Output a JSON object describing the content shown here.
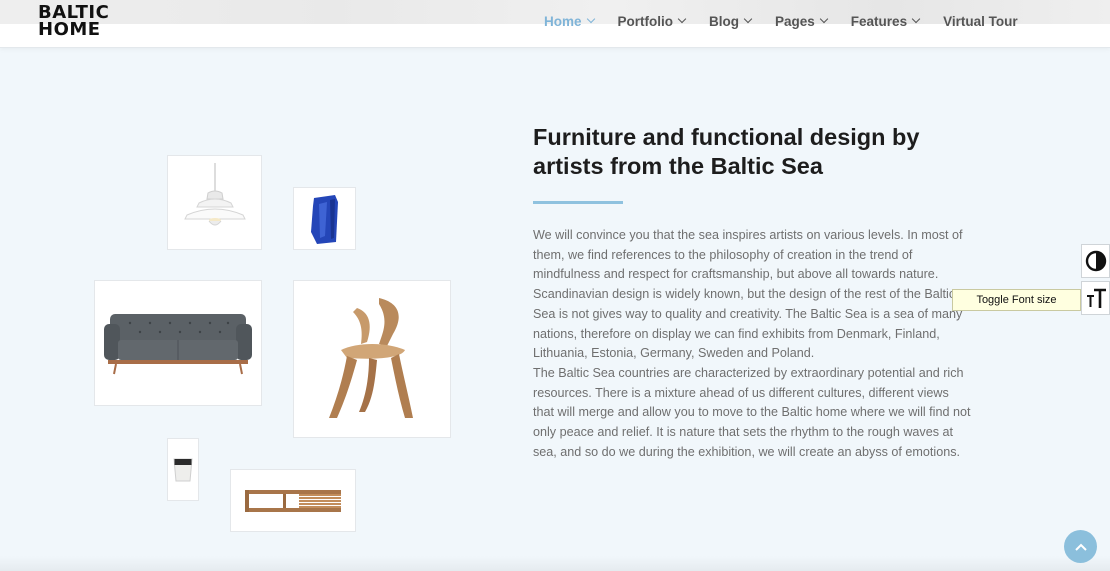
{
  "logo": {
    "line1": "BALTIC",
    "line2": "HOME"
  },
  "nav": {
    "items": [
      {
        "label": "Home",
        "active": true,
        "dropdown": true
      },
      {
        "label": "Portfolio",
        "active": false,
        "dropdown": true
      },
      {
        "label": "Blog",
        "active": false,
        "dropdown": true
      },
      {
        "label": "Pages",
        "active": false,
        "dropdown": true
      },
      {
        "label": "Features",
        "active": false,
        "dropdown": true
      },
      {
        "label": "Virtual Tour",
        "active": false,
        "dropdown": false
      }
    ]
  },
  "gallery": [
    {
      "name": "pendant-lamp-image"
    },
    {
      "name": "blue-vase-image"
    },
    {
      "name": "grey-sofa-image"
    },
    {
      "name": "wooden-chair-image"
    },
    {
      "name": "cup-image"
    },
    {
      "name": "wooden-shelf-image"
    }
  ],
  "content": {
    "headline": "Furniture and functional design by artists from the Baltic Sea",
    "paragraphs": [
      "We will convince you that the sea inspires artists on various levels. In most of them, we find references to the philosophy of creation in the trend of mindfulness and respect for craftsmanship, but above all towards nature.",
      "Scandinavian design is widely known, but the design of the rest of the Baltic Sea is not gives way to quality and creativity. The Baltic Sea is a sea of many nations, therefore on display we can find exhibits from Denmark, Finland, Lithuania, Estonia, Germany, Sweden and Poland.",
      "The Baltic Sea countries are characterized by extraordinary potential and rich resources. There is a mixture ahead of us different cultures, different views that will merge and allow you to move to the Baltic home where we will find not only peace and relief. It is nature that sets the rhythm to the rough waves at sea, and so do we during the exhibition, we will create an abyss of emotions."
    ]
  },
  "accessibility": {
    "contrast_icon": "contrast-icon",
    "font_size_icon": "font-size-icon",
    "tooltip": "Toggle Font size"
  },
  "scroll_top_icon": "chevron-up-icon",
  "colors": {
    "accent": "#7fb4d8",
    "background": "#f1f7fb",
    "heading": "#1d1d1d",
    "body": "#6f6f6f"
  }
}
